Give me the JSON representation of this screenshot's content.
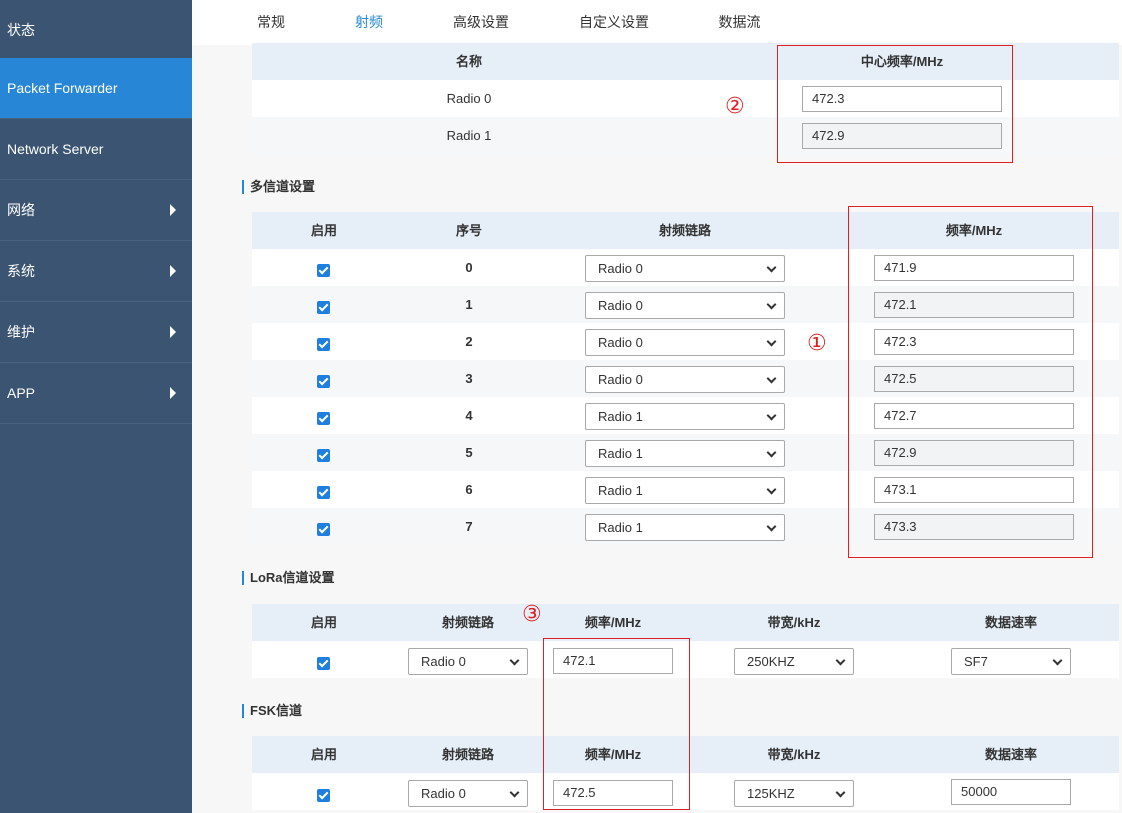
{
  "sidebar": {
    "items": [
      {
        "label": "状态",
        "has_arrow": false,
        "active": false
      },
      {
        "label": "Packet Forwarder",
        "has_arrow": false,
        "active": true
      },
      {
        "label": "Network Server",
        "has_arrow": false,
        "active": false
      },
      {
        "label": "网络",
        "has_arrow": true,
        "active": false
      },
      {
        "label": "系统",
        "has_arrow": true,
        "active": false
      },
      {
        "label": "维护",
        "has_arrow": true,
        "active": false
      },
      {
        "label": "APP",
        "has_arrow": true,
        "active": false
      }
    ]
  },
  "tabs": [
    {
      "label": "常规",
      "active": false
    },
    {
      "label": "射频",
      "active": true
    },
    {
      "label": "高级设置",
      "active": false
    },
    {
      "label": "自定义设置",
      "active": false
    },
    {
      "label": "数据流",
      "active": false
    }
  ],
  "radio_table": {
    "headers": {
      "name": "名称",
      "center_freq": "中心频率/MHz"
    },
    "rows": [
      {
        "name": "Radio 0",
        "freq": "472.3",
        "readonly": false
      },
      {
        "name": "Radio 1",
        "freq": "472.9",
        "readonly": true
      }
    ]
  },
  "multi_channel": {
    "title": "多信道设置",
    "headers": {
      "enable": "启用",
      "index": "序号",
      "radio": "射频链路",
      "freq": "频率/MHz"
    },
    "rows": [
      {
        "index": "0",
        "radio": "Radio 0",
        "freq": "471.9",
        "readonly": false
      },
      {
        "index": "1",
        "radio": "Radio 0",
        "freq": "472.1",
        "readonly": true
      },
      {
        "index": "2",
        "radio": "Radio 0",
        "freq": "472.3",
        "readonly": false
      },
      {
        "index": "3",
        "radio": "Radio 0",
        "freq": "472.5",
        "readonly": true
      },
      {
        "index": "4",
        "radio": "Radio 1",
        "freq": "472.7",
        "readonly": false
      },
      {
        "index": "5",
        "radio": "Radio 1",
        "freq": "472.9",
        "readonly": true
      },
      {
        "index": "6",
        "radio": "Radio 1",
        "freq": "473.1",
        "readonly": false
      },
      {
        "index": "7",
        "radio": "Radio 1",
        "freq": "473.3",
        "readonly": true
      }
    ]
  },
  "lora_channel": {
    "title": "LoRa信道设置",
    "headers": {
      "enable": "启用",
      "radio": "射频链路",
      "freq": "频率/MHz",
      "bandwidth": "带宽/kHz",
      "datarate": "数据速率"
    },
    "row": {
      "radio": "Radio 0",
      "freq": "472.1",
      "bandwidth": "250KHZ",
      "datarate": "SF7"
    }
  },
  "fsk_channel": {
    "title": "FSK信道",
    "headers": {
      "enable": "启用",
      "radio": "射频链路",
      "freq": "频率/MHz",
      "bandwidth": "带宽/kHz",
      "datarate": "数据速率"
    },
    "row": {
      "radio": "Radio 0",
      "freq": "472.5",
      "bandwidth": "125KHZ",
      "datarate": "50000"
    }
  },
  "annotations": {
    "m1": "①",
    "m2": "②",
    "m3": "③"
  },
  "colors": {
    "accent": "#2787d6",
    "sidebar": "#3b5471",
    "highlight": "#e02020"
  }
}
